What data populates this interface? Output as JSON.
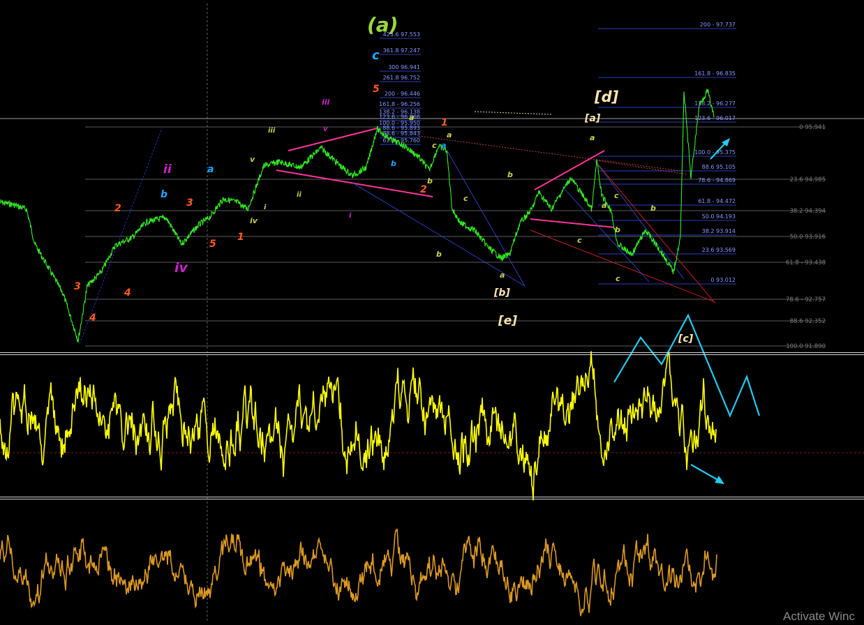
{
  "watermark": "Activate Winc",
  "colors": {
    "background": "#000000",
    "price": "#33ee22",
    "oscillator1": "#ffff00",
    "oscillator2": "#dd9922",
    "fib": "#3355ff",
    "fib_text": "#8899ff",
    "grid": "#7a7a7a",
    "channel": "#ff3399",
    "projection": "#22ccee",
    "wave_blue": "#1ea7ff",
    "wave_orange": "#ff5a1f",
    "wave_olive": "#c8d24a",
    "wave_magenta": "#cc22cc",
    "wave_white": "#ffe6b0",
    "wave_green_big": "#9bd83a"
  },
  "chart_data": [
    {
      "type": "line",
      "name": "price",
      "right_axis_levels": [
        {
          "label": "0 95.941"
        },
        {
          "label": "23.6 94.985"
        },
        {
          "label": "38.2 94.394"
        },
        {
          "label": "50.0 93.916"
        },
        {
          "label": "61.8 - 93.438"
        },
        {
          "label": "78.6 - 92.757"
        },
        {
          "label": "88.6 92.352"
        },
        {
          "label": "100.0 91.890"
        }
      ],
      "fib_set_a": [
        "423.6 97.553",
        "361.8 97.247",
        "300 96.941",
        "261.8 96.752",
        "200 - 96.446",
        "161.8 - 96.256",
        "138.2 - 96.138",
        "123.6 - 96.066",
        "100.0 - 95.950",
        "88.6 - 95.893",
        "78.6 - 95.843",
        "61.8 - 95.760"
      ],
      "fib_set_b": [
        "200 - 97.737",
        "161.8 - 96.835",
        "138.2 - 96.277",
        "123.6 - 96.017",
        "100.0 - 95.375",
        "88.6 95.105",
        "78.6 - 94.869",
        "61.8 - 94.472",
        "50.0 94.193",
        "38.2 93.914",
        "23.6 93.569",
        "0 93.012"
      ],
      "wave_labels": [
        {
          "text": "(a)",
          "color": "wave_green_big"
        },
        {
          "text": "c",
          "color": "wave_blue"
        },
        {
          "text": "5",
          "color": "wave_orange"
        },
        {
          "text": "iii",
          "color": "wave_magenta"
        },
        {
          "text": "v",
          "color": "wave_magenta"
        },
        {
          "text": "iii",
          "color": "wave_olive"
        },
        {
          "text": "v",
          "color": "wave_olive"
        },
        {
          "text": "i",
          "color": "wave_olive"
        },
        {
          "text": "ii",
          "color": "wave_olive"
        },
        {
          "text": "iv",
          "color": "wave_olive"
        },
        {
          "text": "i",
          "color": "wave_magenta"
        },
        {
          "text": "ii",
          "color": "wave_magenta"
        },
        {
          "text": "iv",
          "color": "wave_magenta"
        },
        {
          "text": "a",
          "color": "wave_blue"
        },
        {
          "text": "b",
          "color": "wave_blue"
        },
        {
          "text": "3",
          "color": "wave_orange"
        },
        {
          "text": "5",
          "color": "wave_orange"
        },
        {
          "text": "1",
          "color": "wave_orange"
        },
        {
          "text": "2",
          "color": "wave_orange"
        },
        {
          "text": "4",
          "color": "wave_orange"
        },
        {
          "text": "3",
          "color": "wave_orange"
        },
        {
          "text": "4",
          "color": "wave_orange"
        },
        {
          "text": "1",
          "color": "wave_orange"
        },
        {
          "text": "2",
          "color": "wave_orange"
        },
        {
          "text": "[b]",
          "color": "wave_white"
        },
        {
          "text": "[a]",
          "color": "wave_white"
        },
        {
          "text": "[c]",
          "color": "wave_white"
        },
        {
          "text": "[d]",
          "color": "wave_white"
        },
        {
          "text": "[e]",
          "color": "wave_white"
        },
        {
          "text": "b",
          "color": "wave_blue"
        },
        {
          "text": "a",
          "color": "wave_blue"
        },
        {
          "text": "a",
          "color": "wave_olive"
        },
        {
          "text": "b",
          "color": "wave_olive"
        },
        {
          "text": "c",
          "color": "wave_olive"
        },
        {
          "text": "a",
          "color": "wave_olive"
        },
        {
          "text": "c",
          "color": "wave_olive"
        },
        {
          "text": "b",
          "color": "wave_olive"
        },
        {
          "text": "a",
          "color": "wave_olive"
        },
        {
          "text": "b",
          "color": "wave_olive"
        },
        {
          "text": "c",
          "color": "wave_olive"
        },
        {
          "text": "a",
          "color": "wave_olive"
        },
        {
          "text": "b",
          "color": "wave_olive"
        },
        {
          "text": "c",
          "color": "wave_olive"
        },
        {
          "text": "b",
          "color": "wave_olive"
        },
        {
          "text": "a",
          "color": "wave_olive"
        },
        {
          "text": "c",
          "color": "wave_olive"
        },
        {
          "text": "a",
          "color": "wave_olive"
        }
      ]
    },
    {
      "type": "line",
      "name": "oscillator-1"
    },
    {
      "type": "line",
      "name": "oscillator-2"
    }
  ]
}
